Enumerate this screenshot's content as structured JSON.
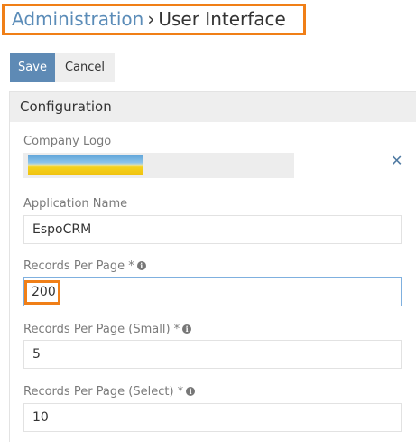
{
  "breadcrumb": {
    "parent": "Administration",
    "separator": "›",
    "current": "User Interface"
  },
  "toolbar": {
    "save_label": "Save",
    "cancel_label": "Cancel"
  },
  "panel": {
    "title": "Configuration",
    "fields": {
      "company_logo": {
        "label": "Company Logo",
        "remove_icon": "close-icon"
      },
      "application_name": {
        "label": "Application Name",
        "value": "EspoCRM"
      },
      "records_per_page": {
        "label": "Records Per Page *",
        "value": "200"
      },
      "records_per_page_small": {
        "label": "Records Per Page (Small) *",
        "value": "5"
      },
      "records_per_page_select": {
        "label": "Records Per Page (Select) *",
        "value": "10"
      }
    }
  },
  "colors": {
    "accent": "#5e8ab5",
    "highlight": "#f07f17",
    "link": "#5b8cb8"
  }
}
